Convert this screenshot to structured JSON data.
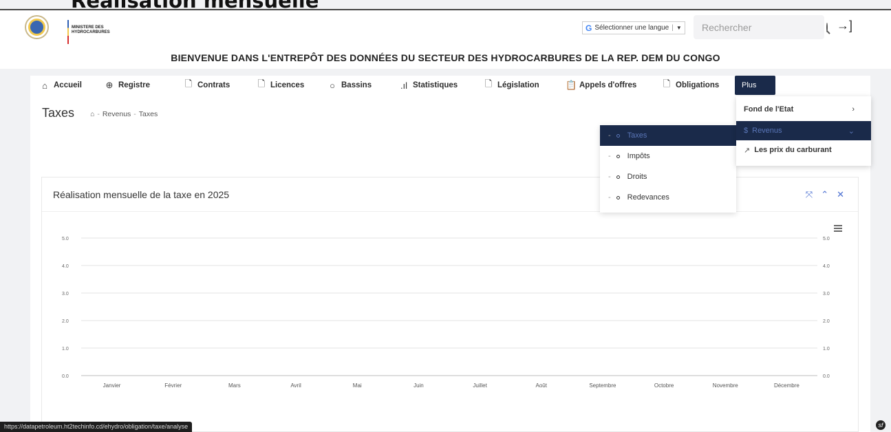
{
  "top_heading": "Réalisation mensuelle",
  "header": {
    "logo_text_line1": "MINISTERE DES",
    "logo_text_line2": "HYDROCARBURES",
    "lang_icon": "G",
    "lang_label": "Sélectionner une langue",
    "lang_caret": "▼",
    "search_placeholder": "Rechercher",
    "login_icon": "→]",
    "welcome": "BIENVENUE DANS L'ENTREPÔT DES DONNÉES DU SECTEUR DES HYDROCARBURES DE LA REP. DEM DU CONGO"
  },
  "nav": {
    "items": [
      {
        "label": "Accueil",
        "icon": "⌂"
      },
      {
        "label": "Registre",
        "icon": "⊕"
      },
      {
        "label": "Contrats",
        "icon": "🗋"
      },
      {
        "label": "Licences",
        "icon": "🗋"
      },
      {
        "label": "Bassins",
        "icon": "○"
      },
      {
        "label": "Statistiques",
        "icon": ".ıl"
      },
      {
        "label": "Législation",
        "icon": "🗋"
      },
      {
        "label": "Appels d'offres",
        "icon": "📋"
      },
      {
        "label": "Obligations",
        "icon": "🗋"
      }
    ],
    "plus_label": "Plus"
  },
  "page": {
    "title": "Taxes",
    "breadcrumb_home_icon": "⌂",
    "breadcrumb": [
      "Revenus",
      "Taxes"
    ],
    "breadcrumb_sep": "-"
  },
  "dropdown": {
    "items": [
      {
        "label": "Fond de l'Etat",
        "chevron": "›"
      },
      {
        "label": "Revenus",
        "icon": "$",
        "chevron": "⌄"
      },
      {
        "label": "Les prix du carburant",
        "icon": "↗"
      }
    ]
  },
  "submenu": {
    "items": [
      "Taxes",
      "Impôts",
      "Droits",
      "Redevances"
    ]
  },
  "card": {
    "title": "Réalisation mensuelle de la taxe en 2025",
    "tools": [
      "⤧",
      "⌃",
      "✕"
    ]
  },
  "chart_data": {
    "type": "bar",
    "categories": [
      "Janvier",
      "Février",
      "Mars",
      "Avril",
      "Mai",
      "Juin",
      "Juillet",
      "Août",
      "Septembre",
      "Octobre",
      "Novembre",
      "Décembre"
    ],
    "values": [],
    "y_ticks": [
      "0.0",
      "1.0",
      "2.0",
      "3.0",
      "4.0",
      "5.0"
    ],
    "ylim": [
      0,
      5
    ],
    "grid": true,
    "title": "",
    "xlabel": "",
    "ylabel": ""
  },
  "status_url": "https://datapetroleum.ht2techinfo.cd/ehydro/obligation/taxe/analyse",
  "sf_icon": "sf"
}
